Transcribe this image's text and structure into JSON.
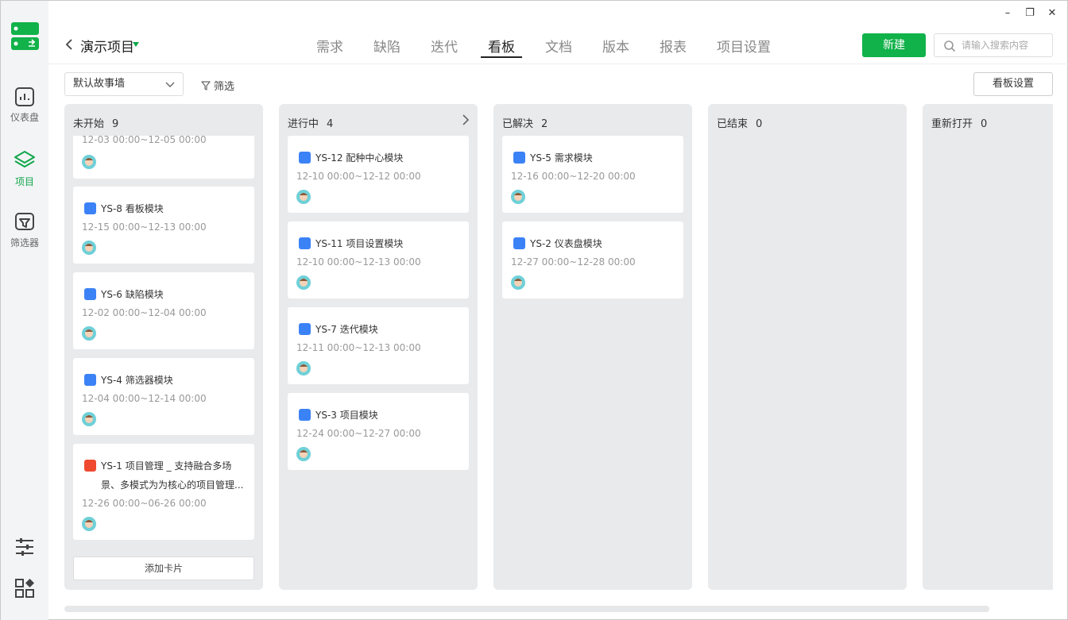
{
  "rail": {
    "items": [
      {
        "label": "仪表盘",
        "icon": "dashboard-icon"
      },
      {
        "label": "项目",
        "icon": "layers-icon"
      },
      {
        "label": "筛选器",
        "icon": "filter-board-icon"
      }
    ],
    "bottom_icons": [
      "sliders-icon",
      "apps-grid-icon"
    ]
  },
  "header": {
    "project": "演示项目",
    "tabs": [
      "需求",
      "缺陷",
      "迭代",
      "看板",
      "文档",
      "版本",
      "报表",
      "项目设置"
    ],
    "active_tab": "看板",
    "new_button": "新建",
    "search_placeholder": "请输入搜索内容"
  },
  "toolbar": {
    "board_select": "默认故事墙",
    "filter_label": "筛选",
    "settings_button": "看板设置"
  },
  "columns": [
    {
      "name": "未开始",
      "count": "9",
      "cards": [
        {
          "id": "",
          "title": "",
          "date": "12-03 00:00~12-05 00:00",
          "type": "story"
        },
        {
          "id": "YS-8",
          "title": "看板模块",
          "date": "12-15 00:00~12-13 00:00",
          "type": "story"
        },
        {
          "id": "YS-6",
          "title": "缺陷模块",
          "date": "12-02 00:00~12-04 00:00",
          "type": "story"
        },
        {
          "id": "YS-4",
          "title": "筛选器模块",
          "date": "12-04 00:00~12-14 00:00",
          "type": "story"
        },
        {
          "id": "YS-1",
          "title": "项目管理 _ 支持融合多场",
          "title2": "景、多模式为为核心的项目管理...",
          "date": "12-26 00:00~06-26 00:00",
          "type": "epic"
        }
      ],
      "add_label": "添加卡片"
    },
    {
      "name": "进行中",
      "count": "4",
      "cards": [
        {
          "id": "YS-12",
          "title": "配种中心模块",
          "date": "12-10 00:00~12-12 00:00",
          "type": "story"
        },
        {
          "id": "YS-11",
          "title": "项目设置模块",
          "date": "12-10 00:00~12-13 00:00",
          "type": "story"
        },
        {
          "id": "YS-7",
          "title": "迭代模块",
          "date": "12-11 00:00~12-13 00:00",
          "type": "story"
        },
        {
          "id": "YS-3",
          "title": "项目模块",
          "date": "12-24 00:00~12-27 00:00",
          "type": "story"
        }
      ]
    },
    {
      "name": "已解决",
      "count": "2",
      "cards": [
        {
          "id": "YS-5",
          "title": "需求模块",
          "date": "12-16 00:00~12-20 00:00",
          "type": "story"
        },
        {
          "id": "YS-2",
          "title": "仪表盘模块",
          "date": "12-27 00:00~12-28 00:00",
          "type": "story"
        }
      ]
    },
    {
      "name": "已结束",
      "count": "0",
      "cards": []
    },
    {
      "name": "重新打开",
      "count": "0",
      "cards": []
    }
  ],
  "colors": {
    "accent": "#11b24a",
    "story_badge": "#3b82f6",
    "epic_badge": "#ef4a2f"
  }
}
